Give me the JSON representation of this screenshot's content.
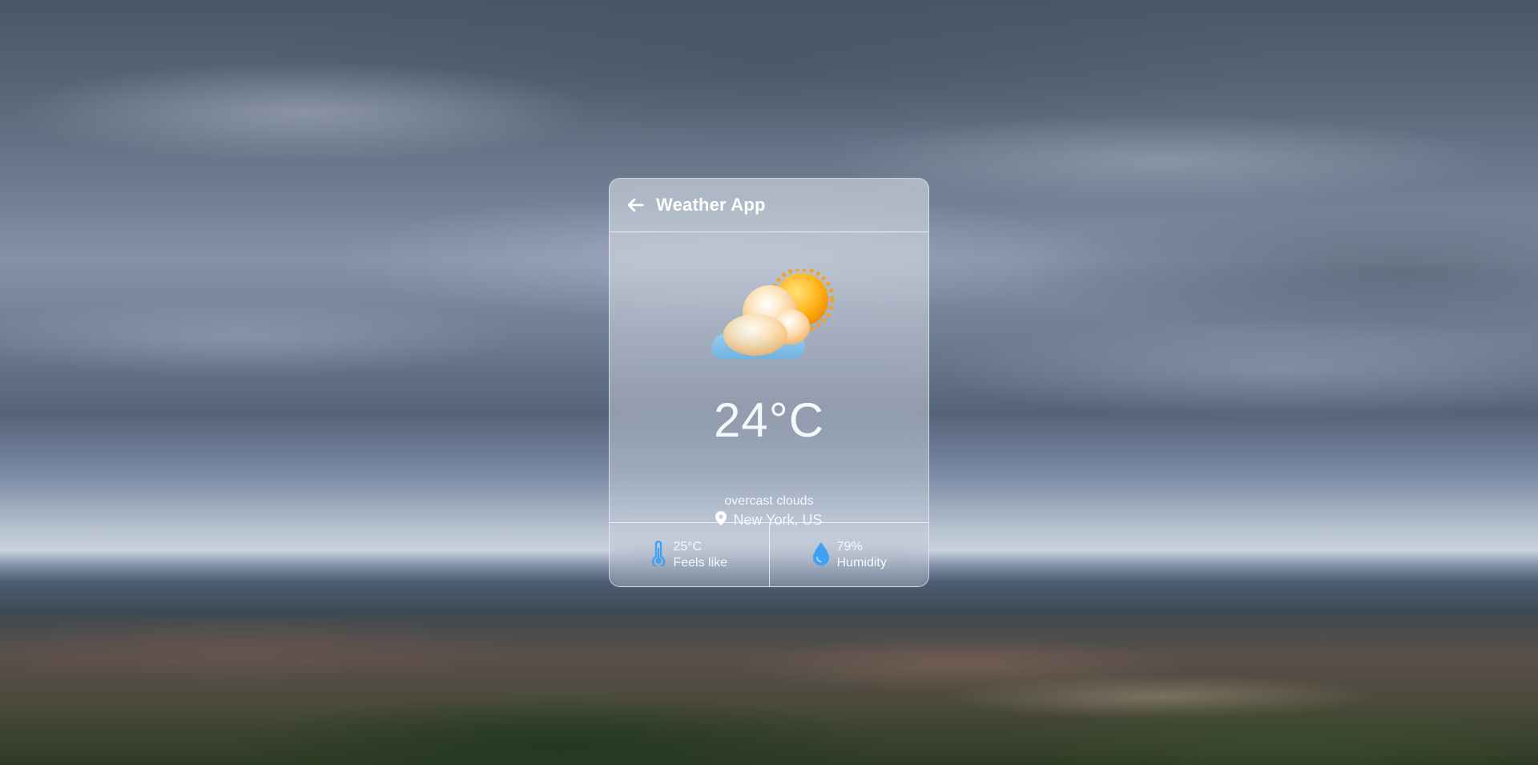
{
  "app": {
    "title": "Weather App"
  },
  "weather": {
    "temperature": "24°C",
    "description": "overcast clouds",
    "location": "New York, US",
    "icon": "partly-cloudy-icon"
  },
  "stats": {
    "feels_like": {
      "value": "25°C",
      "label": "Feels like",
      "icon": "thermometer-icon"
    },
    "humidity": {
      "value": "79%",
      "label": "Humidity",
      "icon": "water-drop-icon"
    }
  },
  "colors": {
    "accent": "#3fa1f5",
    "card_text": "#ffffff"
  }
}
